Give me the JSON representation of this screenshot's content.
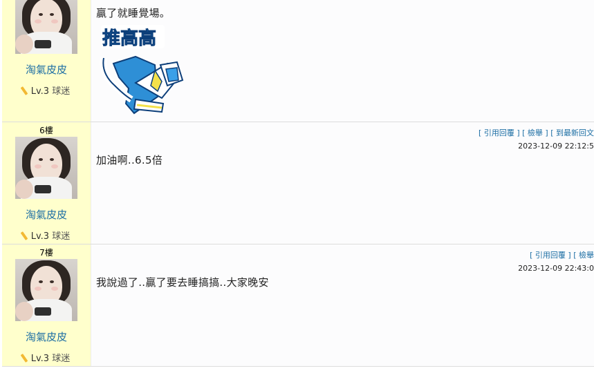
{
  "posts": [
    {
      "floor": "",
      "username": "淘氣皮皮",
      "level": "Lv.3",
      "rank": "球迷",
      "actions": [],
      "timestamp": "",
      "message": "贏了就睡覺場。",
      "sticker_text": "推高高"
    },
    {
      "floor": "6樓",
      "username": "淘氣皮皮",
      "level": "Lv.3",
      "rank": "球迷",
      "actions": [
        "引用回覆",
        "檢舉",
        "到最新回文"
      ],
      "timestamp": "2023-12-09 22:12:5",
      "message": "加油啊..6.5倍"
    },
    {
      "floor": "7樓",
      "username": "淘氣皮皮",
      "level": "Lv.3",
      "rank": "球迷",
      "actions": [
        "引用回覆",
        "檢舉"
      ],
      "timestamp": "2023-12-09 22:43:0",
      "message": "我說過了..贏了要去睡搞搞..大家晚安"
    }
  ],
  "icons": {
    "level": "pencil-icon"
  }
}
